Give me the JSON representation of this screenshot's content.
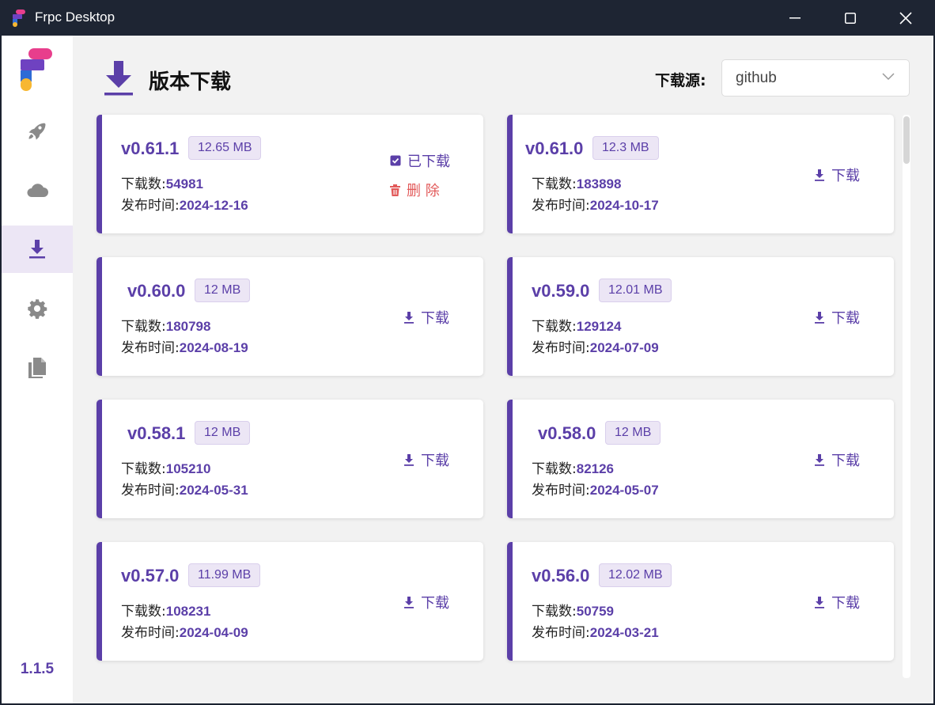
{
  "window": {
    "title": "Frpc Desktop"
  },
  "sidebar": {
    "items": [
      {
        "name": "rocket-icon"
      },
      {
        "name": "cloud-icon"
      },
      {
        "name": "download-icon",
        "active": true
      },
      {
        "name": "gear-icon"
      },
      {
        "name": "copy-icon"
      }
    ],
    "version": "1.1.5"
  },
  "header": {
    "title": "版本下载",
    "source_label": "下载源:",
    "source_value": "github"
  },
  "labels": {
    "downloads": "下载数:",
    "published": "发布时间:",
    "download": "下载",
    "downloaded": "已下载",
    "delete": "删 除"
  },
  "colors": {
    "accent": "#5b3fa8",
    "danger": "#e25a5a",
    "titlebar": "#1e2533"
  },
  "versions": [
    {
      "version": "v0.61.1",
      "size": "12.65 MB",
      "downloads": "54981",
      "date": "2024-12-16",
      "downloaded": true
    },
    {
      "version": "v0.61.0",
      "size": "12.3 MB",
      "downloads": "183898",
      "date": "2024-10-17",
      "downloaded": false
    },
    {
      "version": "v0.60.0",
      "size": "12 MB",
      "downloads": "180798",
      "date": "2024-08-19",
      "downloaded": false
    },
    {
      "version": "v0.59.0",
      "size": "12.01 MB",
      "downloads": "129124",
      "date": "2024-07-09",
      "downloaded": false
    },
    {
      "version": "v0.58.1",
      "size": "12 MB",
      "downloads": "105210",
      "date": "2024-05-31",
      "downloaded": false
    },
    {
      "version": "v0.58.0",
      "size": "12 MB",
      "downloads": "82126",
      "date": "2024-05-07",
      "downloaded": false
    },
    {
      "version": "v0.57.0",
      "size": "11.99 MB",
      "downloads": "108231",
      "date": "2024-04-09",
      "downloaded": false
    },
    {
      "version": "v0.56.0",
      "size": "12.02 MB",
      "downloads": "50759",
      "date": "2024-03-21",
      "downloaded": false
    }
  ]
}
